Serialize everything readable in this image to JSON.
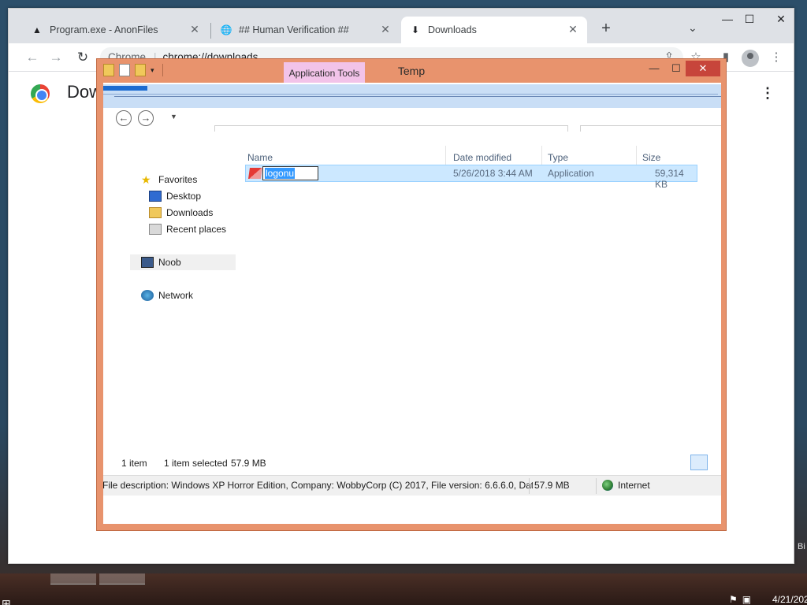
{
  "browser": {
    "tabs": [
      {
        "title": "Program.exe - AnonFiles",
        "icon": "anonfiles-icon"
      },
      {
        "title": "## Human Verification ##",
        "icon": "globe-icon"
      },
      {
        "title": "Downloads",
        "icon": "download-icon"
      }
    ],
    "new_tab": "+",
    "tab_search": "⌄",
    "address_chip": "Chrome",
    "address_url": "chrome://downloads",
    "page_title": "Dow",
    "window_controls": {
      "minimize": "—",
      "maximize": "☐",
      "close": "✕"
    }
  },
  "explorer": {
    "title": "Temp",
    "ribbon_tab": "Application Tools",
    "nav": {
      "favorites": "Favorites",
      "desktop": "Desktop",
      "downloads": "Downloads",
      "recent": "Recent places",
      "computer": "Noob",
      "network": "Network"
    },
    "columns": {
      "name": "Name",
      "date": "Date modified",
      "type": "Type",
      "size": "Size"
    },
    "files": [
      {
        "name": "logonu",
        "date": "5/26/2018 3:44 AM",
        "type": "Application",
        "size": "59,314 KB"
      }
    ],
    "status": {
      "count": "1 item",
      "selected": "1 item selected",
      "selected_size": "57.9 MB"
    },
    "details": {
      "description": "File description: Windows XP Horror Edition, Company: WobbyCorp (C) 2017, File version: 6.6.6.0, Date",
      "size": "57.9 MB",
      "zone": "Internet"
    }
  },
  "taskbar": {
    "clock": "4/21/202",
    "edge_text": "Bi"
  },
  "colors": {
    "explorer_frame": "#e8936d",
    "selection": "#cce8ff",
    "app_tools_tab": "#f2c3e9",
    "close_button": "#c7453b"
  }
}
